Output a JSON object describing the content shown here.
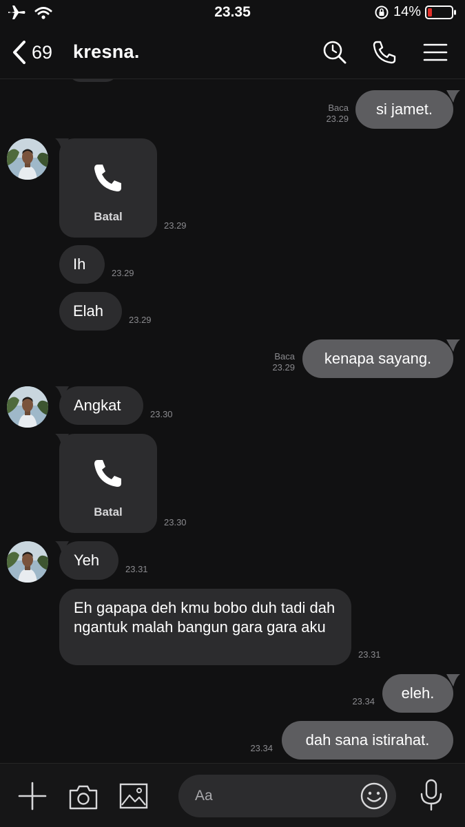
{
  "status_bar": {
    "time": "23.35",
    "battery": "14%"
  },
  "header": {
    "back_count": "69",
    "title": "kresna."
  },
  "messages": [
    {
      "text": "si jamet.",
      "read": "Baca",
      "time": "23.29"
    },
    {
      "call_label": "Batal",
      "time": "23.29"
    },
    {
      "text": "Ih",
      "time": "23.29"
    },
    {
      "text": "Elah",
      "time": "23.29"
    },
    {
      "text": "kenapa sayang.",
      "read": "Baca",
      "time": "23.29"
    },
    {
      "text": "Angkat",
      "time": "23.30"
    },
    {
      "call_label": "Batal",
      "time": "23.30"
    },
    {
      "text": "Yeh",
      "time": "23.31"
    },
    {
      "text": "Eh gapapa deh kmu bobo duh tadi dah ngantuk malah bangun gara gara aku",
      "time": "23.31"
    },
    {
      "text": "eleh.",
      "time": "23.34"
    },
    {
      "text": "dah sana istirahat.",
      "time": "23.34"
    }
  ],
  "composer": {
    "placeholder": "Aa"
  },
  "icons": {
    "airplane": "airplane-icon",
    "wifi": "wifi-icon",
    "rotation_lock": "rotation-lock-icon",
    "battery": "battery-icon",
    "back": "chevron-left-icon",
    "search": "search-icon",
    "call": "phone-icon",
    "menu": "menu-icon",
    "plus": "plus-icon",
    "camera": "camera-icon",
    "gallery": "image-icon",
    "emoji": "smiley-icon",
    "mic": "microphone-icon"
  },
  "colors": {
    "background": "#111112",
    "incoming_bubble": "#2c2c2e",
    "outgoing_bubble": "#5d5d60",
    "battery_low": "#e0302a"
  }
}
